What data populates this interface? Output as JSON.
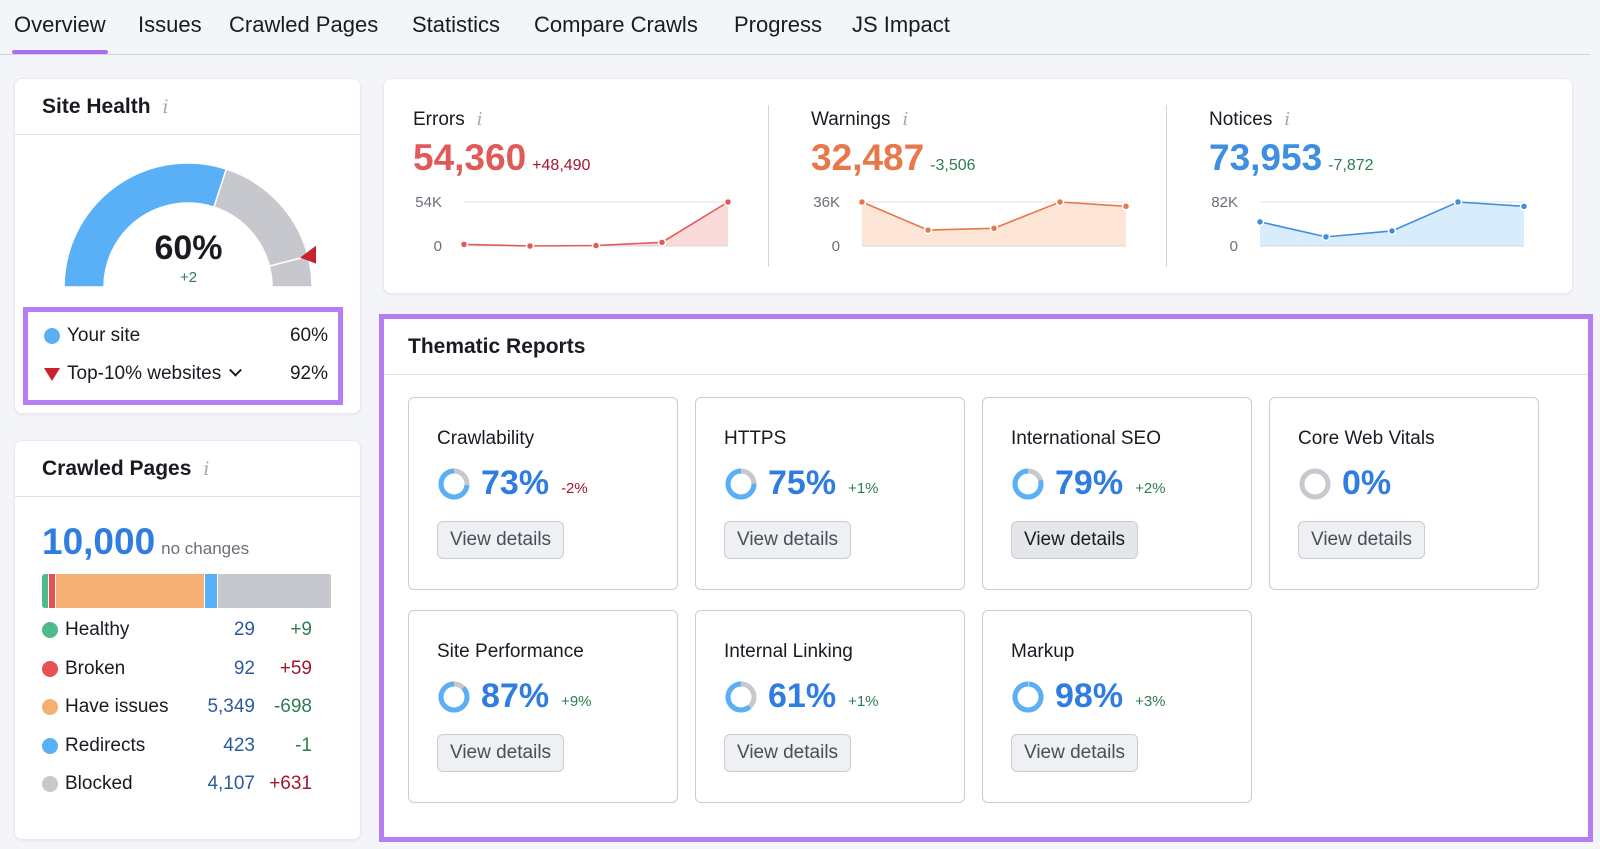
{
  "tabs": [
    {
      "label": "Overview",
      "active": true
    },
    {
      "label": "Issues"
    },
    {
      "label": "Crawled Pages"
    },
    {
      "label": "Statistics"
    },
    {
      "label": "Compare Crawls"
    },
    {
      "label": "Progress"
    },
    {
      "label": "JS Impact"
    }
  ],
  "site_health": {
    "title": "Site Health",
    "info_icon": "i",
    "value": "60%",
    "value_fraction": 0.6,
    "delta": "+2",
    "top10_fraction": 0.92,
    "legend": [
      {
        "label": "Your site",
        "value": "60%",
        "color": "#59b0f6",
        "marker": "dot"
      },
      {
        "label": "Top-10% websites",
        "value": "92%",
        "color": "#c8202e",
        "marker": "triangle",
        "dropdown": true
      }
    ]
  },
  "crawled_pages": {
    "title": "Crawled Pages",
    "info_icon": "i",
    "total": "10,000",
    "total_note": "no changes",
    "rows": [
      {
        "label": "Healthy",
        "value": "29",
        "change": "+9",
        "change_tone": "good",
        "color": "#4fbb8a",
        "share": 0.0029
      },
      {
        "label": "Broken",
        "value": "92",
        "change": "+59",
        "change_tone": "bad",
        "color": "#e85055",
        "share": 0.0092
      },
      {
        "label": "Have issues",
        "value": "5,349",
        "change": "-698",
        "change_tone": "good",
        "color": "#f3b072",
        "share": 0.5349
      },
      {
        "label": "Redirects",
        "value": "423",
        "change": "-1",
        "change_tone": "good",
        "color": "#59b0f6",
        "share": 0.0423
      },
      {
        "label": "Blocked",
        "value": "4,107",
        "change": "+631",
        "change_tone": "bad",
        "color": "#c6c8cd",
        "share": 0.4107
      }
    ]
  },
  "issues": [
    {
      "label": "Errors",
      "value": "54,360",
      "delta": "+48,490",
      "delta_tone": "bad",
      "color": "#e05a5a",
      "fill": "#fbdada",
      "ymax_label": "54K",
      "ymin_label": "0",
      "ymax": 54000,
      "points": [
        2000,
        0,
        600,
        4500,
        54360
      ]
    },
    {
      "label": "Warnings",
      "value": "32,487",
      "delta": "-3,506",
      "delta_tone": "good",
      "color": "#e8774a",
      "fill": "#fde6d8",
      "ymax_label": "36K",
      "ymin_label": "0",
      "ymax": 36000,
      "points": [
        36000,
        13000,
        14500,
        36000,
        32487
      ]
    },
    {
      "label": "Notices",
      "value": "73,953",
      "delta": "-7,872",
      "delta_tone": "good",
      "color": "#3d8fe0",
      "fill": "#d9ecfc",
      "ymax_label": "82K",
      "ymin_label": "0",
      "ymax": 82000,
      "points": [
        45000,
        17000,
        28000,
        82000,
        73953
      ]
    }
  ],
  "thematic": {
    "title": "Thematic Reports",
    "reports": [
      {
        "title": "Crawlability",
        "score": "73%",
        "fraction": 0.73,
        "delta": "-2%",
        "delta_tone": "bad",
        "button": "View details"
      },
      {
        "title": "HTTPS",
        "score": "75%",
        "fraction": 0.75,
        "delta": "+1%",
        "delta_tone": "good",
        "button": "View details"
      },
      {
        "title": "International SEO",
        "score": "79%",
        "fraction": 0.79,
        "delta": "+2%",
        "delta_tone": "good",
        "button": "View details",
        "hover": true
      },
      {
        "title": "Core Web Vitals",
        "score": "0%",
        "fraction": 0,
        "delta": "",
        "delta_tone": "good",
        "button": "View details"
      },
      {
        "title": "Site Performance",
        "score": "87%",
        "fraction": 0.87,
        "delta": "+9%",
        "delta_tone": "good",
        "button": "View details"
      },
      {
        "title": "Internal Linking",
        "score": "61%",
        "fraction": 0.61,
        "delta": "+1%",
        "delta_tone": "good",
        "button": "View details"
      },
      {
        "title": "Markup",
        "score": "98%",
        "fraction": 0.98,
        "delta": "+3%",
        "delta_tone": "good",
        "button": "View details"
      }
    ]
  }
}
